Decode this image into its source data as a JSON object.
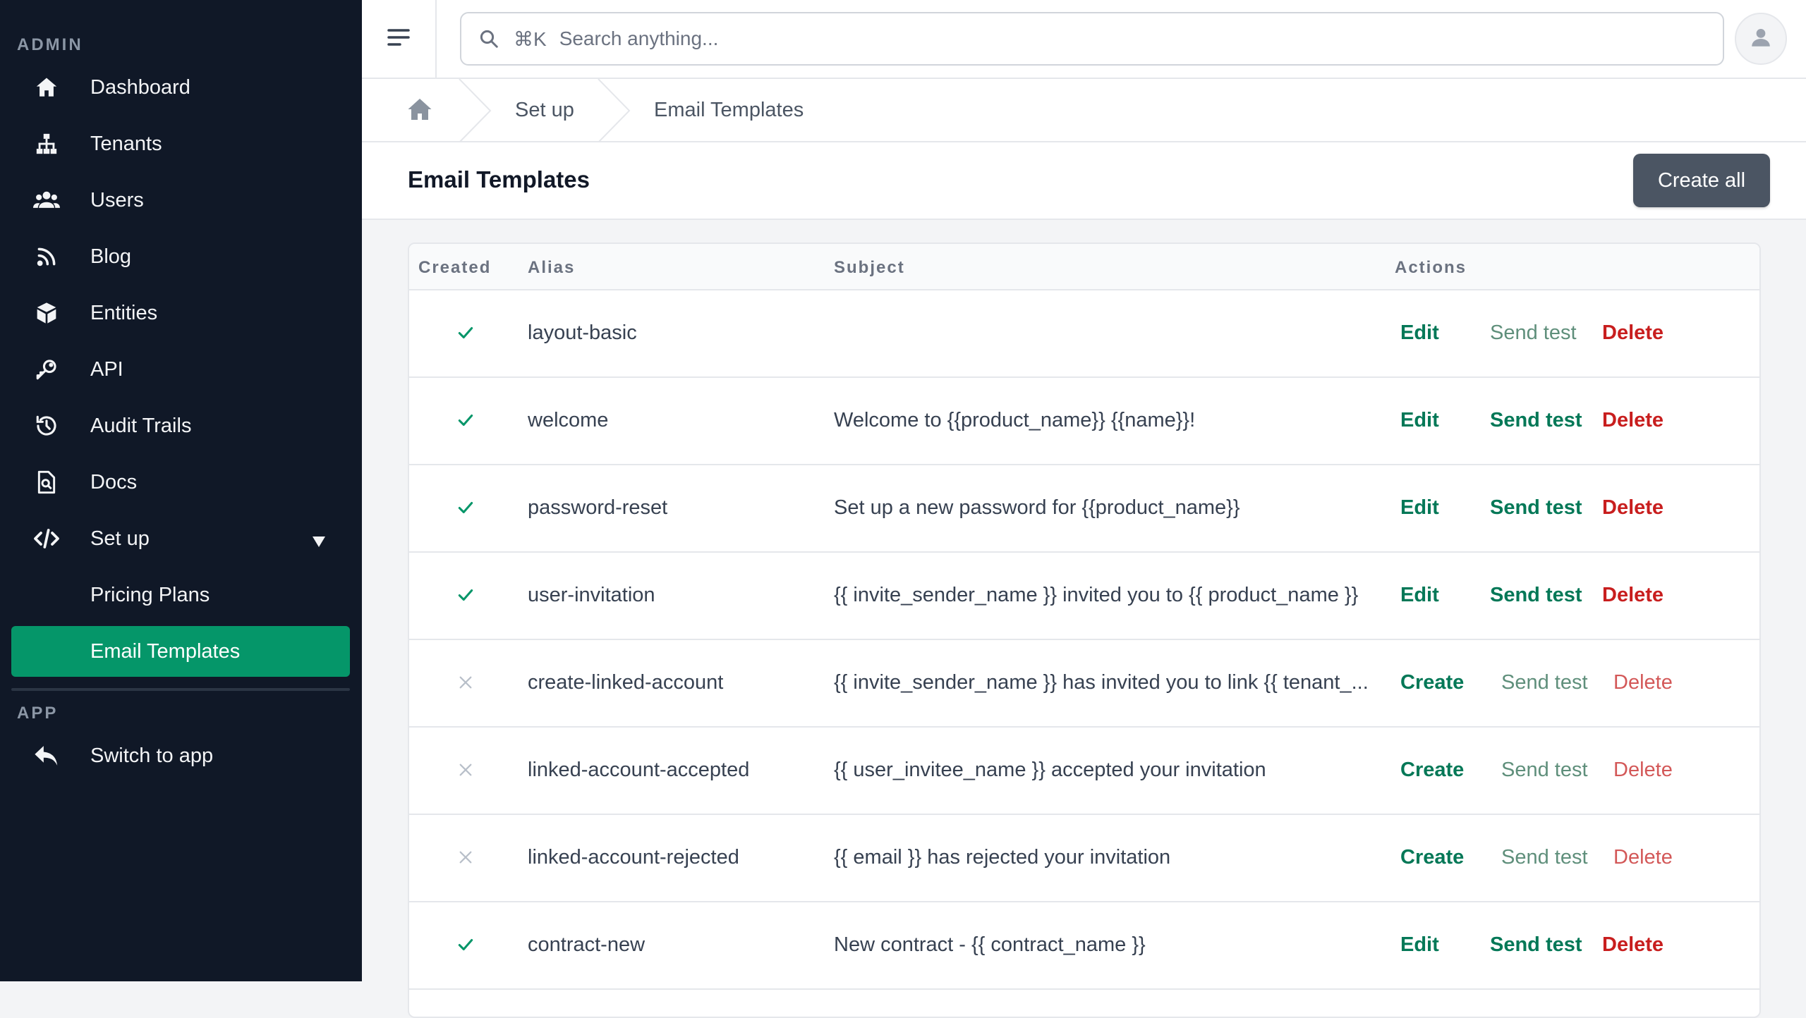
{
  "sidebar": {
    "admin_label": "ADMIN",
    "app_label": "APP",
    "items": [
      {
        "label": "Dashboard",
        "icon": "home-icon"
      },
      {
        "label": "Tenants",
        "icon": "org-chart-icon"
      },
      {
        "label": "Users",
        "icon": "users-icon"
      },
      {
        "label": "Blog",
        "icon": "rss-icon"
      },
      {
        "label": "Entities",
        "icon": "cube-icon"
      },
      {
        "label": "API",
        "icon": "key-icon"
      },
      {
        "label": "Audit Trails",
        "icon": "history-icon"
      },
      {
        "label": "Docs",
        "icon": "document-search-icon"
      },
      {
        "label": "Set up",
        "icon": "code-icon"
      }
    ],
    "subitems": [
      {
        "label": "Pricing Plans"
      },
      {
        "label": "Email Templates",
        "active": true
      }
    ],
    "app_items": [
      {
        "label": "Switch to app",
        "icon": "reply-arrow-icon"
      }
    ],
    "active_color": "#059669",
    "bg_color": "#101827"
  },
  "topbar": {
    "search_shortcut": "⌘K",
    "search_placeholder": "Search anything..."
  },
  "breadcrumb": {
    "items": [
      "Set up",
      "Email Templates"
    ]
  },
  "page": {
    "title": "Email Templates",
    "create_all_label": "Create all"
  },
  "table": {
    "headers": {
      "created": "Created",
      "alias": "Alias",
      "subject": "Subject",
      "actions": "Actions"
    },
    "rows": [
      {
        "created": true,
        "alias": "layout-basic",
        "subject": "",
        "primary": "Edit",
        "send": "Send test",
        "delete": "Delete"
      },
      {
        "created": true,
        "alias": "welcome",
        "subject": "Welcome to {{product_name}} {{name}}!",
        "primary": "Edit",
        "send": "Send test",
        "delete": "Delete"
      },
      {
        "created": true,
        "alias": "password-reset",
        "subject": "Set up a new password for {{product_name}}",
        "primary": "Edit",
        "send": "Send test",
        "delete": "Delete"
      },
      {
        "created": true,
        "alias": "user-invitation",
        "subject": "{{ invite_sender_name }} invited you to {{ product_name }}",
        "primary": "Edit",
        "send": "Send test",
        "delete": "Delete"
      },
      {
        "created": false,
        "alias": "create-linked-account",
        "subject": "{{ invite_sender_name }} has invited you to link {{ tenant_...",
        "primary": "Create",
        "send": "Send test",
        "delete": "Delete"
      },
      {
        "created": false,
        "alias": "linked-account-accepted",
        "subject": "{{ user_invitee_name }} accepted your invitation",
        "primary": "Create",
        "send": "Send test",
        "delete": "Delete"
      },
      {
        "created": false,
        "alias": "linked-account-rejected",
        "subject": "{{ email }} has rejected your invitation",
        "primary": "Create",
        "send": "Send test",
        "delete": "Delete"
      },
      {
        "created": true,
        "alias": "contract-new",
        "subject": "New contract - {{ contract_name }}",
        "primary": "Edit",
        "send": "Send test",
        "delete": "Delete"
      }
    ]
  }
}
